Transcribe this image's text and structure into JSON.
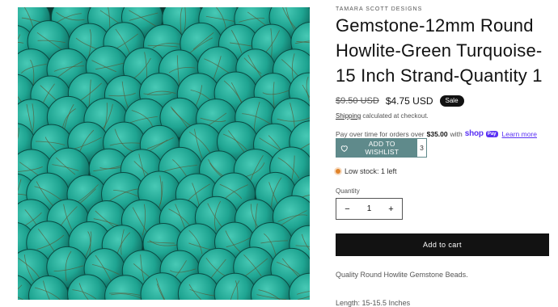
{
  "product": {
    "vendor": "TAMARA SCOTT DESIGNS",
    "title": "Gemstone-12mm Round Howlite-Green Turquoise-15 Inch Strand-Quantity 1",
    "image_alt": "Green turquoise howlite round beads on strands"
  },
  "price": {
    "compare_at": "$9.50 USD",
    "sale": "$4.75 USD",
    "badge": "Sale"
  },
  "shipping": {
    "link": "Shipping",
    "text": "calculated at checkout."
  },
  "installments": {
    "prefix": "Pay over time for orders over",
    "amount": "$35.00",
    "with": "with",
    "shop_logo": "shop",
    "pay_badge": "Pay",
    "learn_more": "Learn more"
  },
  "wishlist": {
    "label": "ADD TO WISHLIST",
    "count": "3",
    "icon": "heart-icon"
  },
  "stock": {
    "text": "Low stock: 1 left",
    "status_color": "#e0832a"
  },
  "quantity": {
    "label": "Quantity",
    "value": "1",
    "minus": "−",
    "plus": "+"
  },
  "cart": {
    "button": "Add to cart"
  },
  "description": {
    "line1": "Quality Round Howlite Gemstone Beads.",
    "line2": "Length: 15-15.5 Inches"
  },
  "colors": {
    "bead": "#1fa592",
    "bead_light": "#48c9b5",
    "bead_dark": "#0f6e62",
    "button_dark": "#121212",
    "wishlist": "#5f8a8b",
    "shop_pay": "#5a31f4"
  }
}
